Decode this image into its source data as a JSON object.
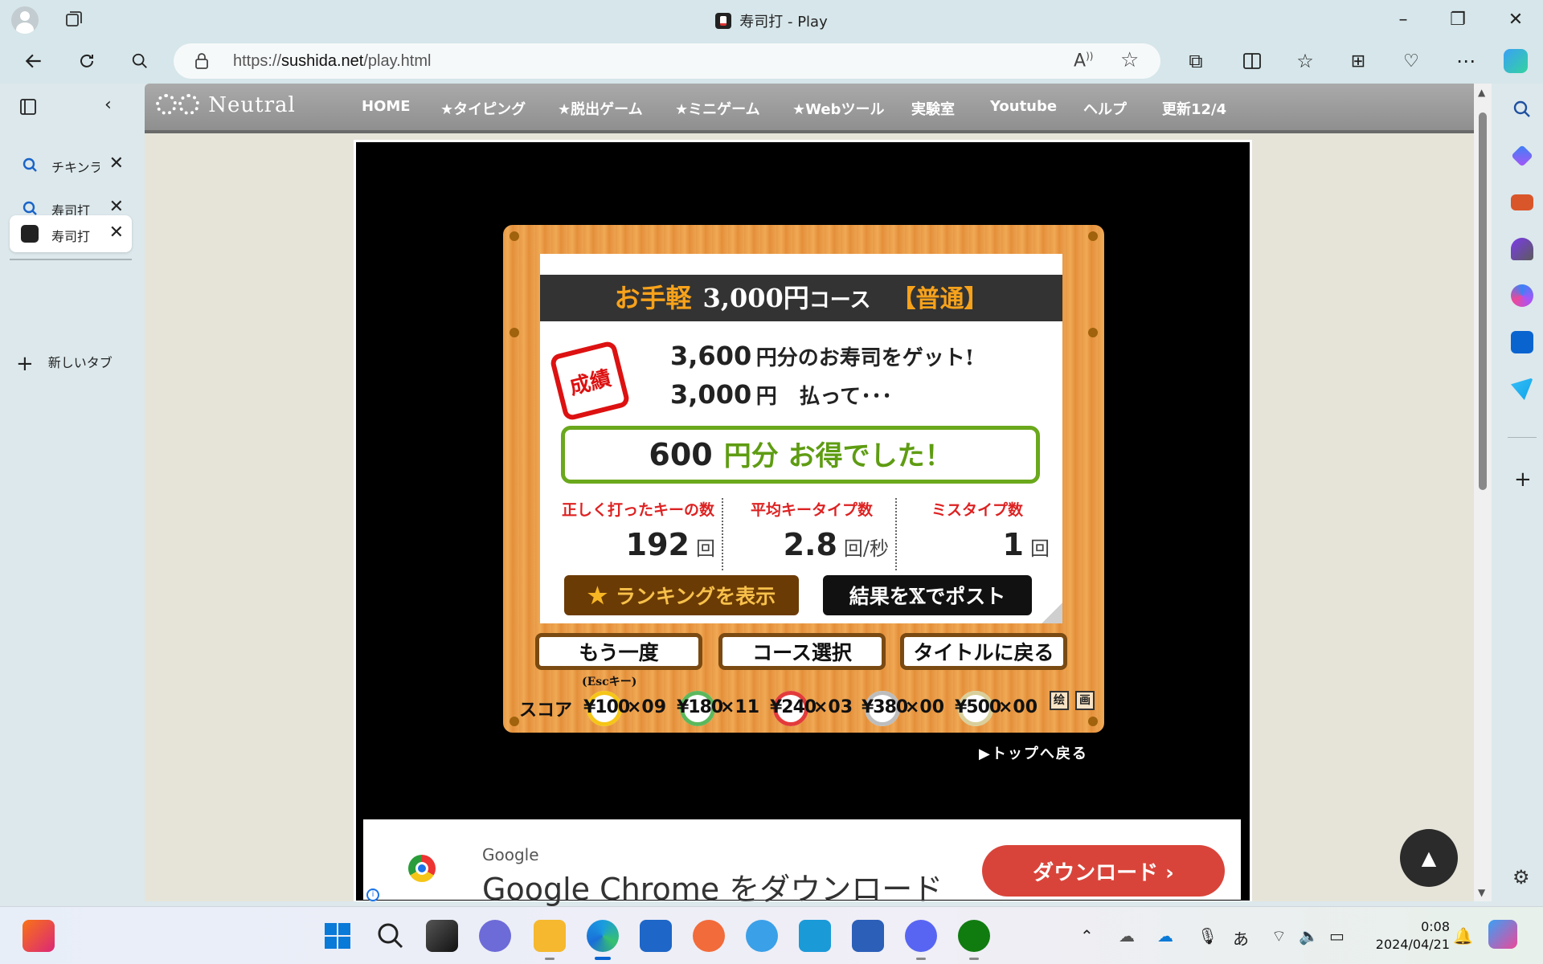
{
  "window": {
    "title": "寿司打 - Play"
  },
  "address_bar": {
    "url_prefix": "https://",
    "url_domain": "sushida.net",
    "url_path": "/play.html"
  },
  "tabs": [
    {
      "label": "チキンラ",
      "icon": "search-icon"
    },
    {
      "label": "寿司打",
      "icon": "search-icon"
    },
    {
      "label": "寿司打",
      "icon": "sushi-favicon",
      "active": true
    }
  ],
  "new_tab_label": "新しいタブ",
  "site": {
    "logo": "Neutral",
    "menu": [
      "HOME",
      "★タイピング",
      "★脱出ゲーム",
      "★ミニゲーム",
      "★Webツール",
      "実験室",
      "Youtube",
      "ヘルプ",
      "更新12/4"
    ]
  },
  "result": {
    "course_name": "お手軽",
    "course_price": "3,000円",
    "course_suffix": "コース",
    "difficulty": "【普通】",
    "stamp": "成績",
    "earned_amount": "3,600",
    "earned_unit": "円分のお寿司をゲット!",
    "paid_amount": "3,000",
    "paid_unit": "円",
    "paid_tail": "払って･･･",
    "profit_amount": "600",
    "profit_text": "円分 お得でした！",
    "stats": [
      {
        "label": "正しく打ったキーの数",
        "value": "192",
        "unit": "回"
      },
      {
        "label": "平均キータイプ数",
        "value": "2.8",
        "unit": "回/秒"
      },
      {
        "label": "ミスタイプ数",
        "value": "1",
        "unit": "回"
      }
    ],
    "ranking_button": "ランキングを表示",
    "post_button": "結果を𝕏でポスト",
    "retry_button": "もう一度",
    "retry_hint": "(Escキー)",
    "course_select_button": "コース選択",
    "title_button": "タイトルに戻る",
    "score_label": "スコア",
    "plates": [
      {
        "price": "¥100",
        "count": "×09",
        "color": "#f5c518"
      },
      {
        "price": "¥180",
        "count": "×11",
        "color": "#5cb85c"
      },
      {
        "price": "¥240",
        "count": "×03",
        "color": "#e33b3b"
      },
      {
        "price": "¥380",
        "count": "×00",
        "color": "#bdbdbd"
      },
      {
        "price": "¥500",
        "count": "×00",
        "color": "#d9cf9b"
      }
    ],
    "mini_icons": [
      "绘",
      "画"
    ],
    "back_to_top": "▶トップへ戻る"
  },
  "ad": {
    "brand": "Google",
    "headline": "Google Chrome をダウンロード",
    "button": "ダウンロード ›"
  },
  "taskbar": {
    "time": "0:08",
    "date": "2024/04/21",
    "ime": "あ"
  }
}
